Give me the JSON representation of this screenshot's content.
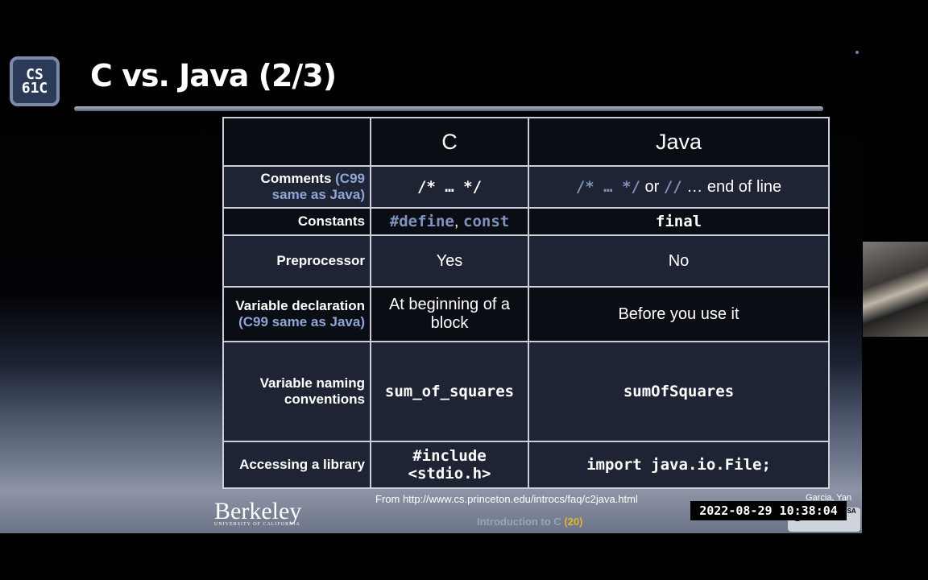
{
  "slide": {
    "logo_line1": "CS",
    "logo_line2": "61C",
    "title": "C vs. Java (2/3)"
  },
  "table": {
    "headers": [
      "",
      "C",
      "Java"
    ],
    "rows": [
      {
        "label": "Comments",
        "label_sub": "(C99 same as Java)",
        "c": "/* … */",
        "java_code1": "/* … */",
        "java_or": "or",
        "java_code2": "//",
        "java_tail": "… end of line"
      },
      {
        "label": "Constants",
        "c_code1": "#define",
        "c_sep": ",",
        "c_code2": "const",
        "java": "final"
      },
      {
        "label": "Preprocessor",
        "c": "Yes",
        "java": "No"
      },
      {
        "label": "Variable declaration",
        "label_sub": "(C99 same as Java)",
        "c": "At beginning of a block",
        "java": "Before you use it"
      },
      {
        "label": "Variable naming conventions",
        "c": "sum_of_squares",
        "java": "sumOfSquares"
      },
      {
        "label": "Accessing a library",
        "c_line1": "#include",
        "c_line2": "<stdio.h>",
        "java": "import java.io.File;"
      }
    ]
  },
  "footer": {
    "source": "From http://www.cs.princeton.edu/introcs/faq/c2java.html",
    "authors": "Garcia, Yan",
    "university": "Berkeley",
    "university_sub": "UNIVERSITY OF CALIFORNIA",
    "lecture": "Introduction to C",
    "slide_number": "(20)",
    "license": [
      "BY",
      "NC",
      "SA"
    ]
  },
  "overlay": {
    "timestamp": "2022-08-29  10:38:04"
  },
  "colors": {
    "code": "#7f93bd",
    "accent": "#8fa6d6",
    "slide_num": "#e6b52e"
  }
}
